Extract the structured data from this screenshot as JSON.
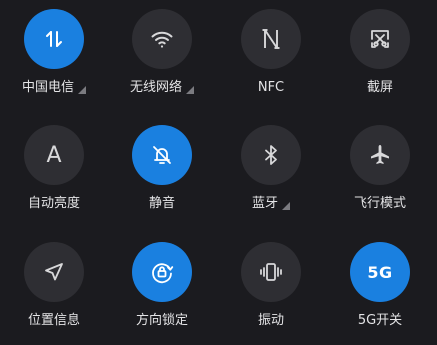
{
  "tiles": [
    {
      "label": "中国电信",
      "icon": "mobile-data-icon",
      "active": true,
      "dropdown": true
    },
    {
      "label": "无线网络",
      "icon": "wifi-icon",
      "active": false,
      "dropdown": true
    },
    {
      "label": "NFC",
      "icon": "nfc-icon",
      "active": false,
      "dropdown": false
    },
    {
      "label": "截屏",
      "icon": "screenshot-icon",
      "active": false,
      "dropdown": false
    },
    {
      "label": "自动亮度",
      "icon": "auto-brightness-icon",
      "active": false,
      "dropdown": false,
      "glyph": "A"
    },
    {
      "label": "静音",
      "icon": "bell-muted-icon",
      "active": true,
      "dropdown": false
    },
    {
      "label": "蓝牙",
      "icon": "bluetooth-icon",
      "active": false,
      "dropdown": true
    },
    {
      "label": "飞行模式",
      "icon": "airplane-icon",
      "active": false,
      "dropdown": false
    },
    {
      "label": "位置信息",
      "icon": "location-icon",
      "active": false,
      "dropdown": false
    },
    {
      "label": "方向锁定",
      "icon": "rotation-lock-icon",
      "active": true,
      "dropdown": false
    },
    {
      "label": "振动",
      "icon": "vibrate-icon",
      "active": false,
      "dropdown": false
    },
    {
      "label": "5G开关",
      "icon": "5g-icon",
      "active": true,
      "dropdown": false,
      "glyph": "5G"
    }
  ],
  "colors": {
    "active": "#1a80e0",
    "inactive": "#2e2e33",
    "background": "#1b1b1f",
    "label": "#e4e4e6"
  }
}
